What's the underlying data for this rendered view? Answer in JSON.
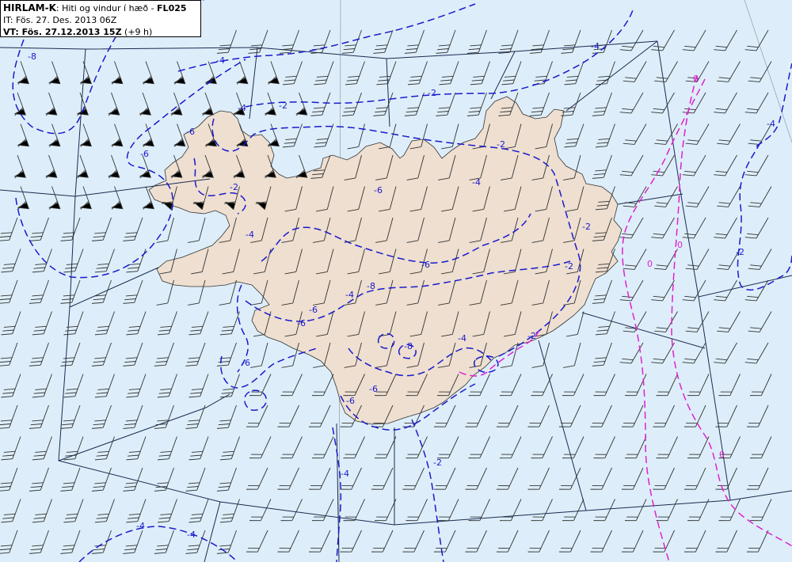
{
  "header": {
    "model": "HIRLAM-K",
    "description": ": Hiti og vindur í hæð - ",
    "level": "FL025",
    "it_line": "IT: Fös. 27. Des. 2013 06Z",
    "vt_label": "VT: ",
    "vt_date": "Fös. 27.12.2013 15Z",
    "vt_lead": " (+9 h)"
  },
  "colors": {
    "sea": "#ddeefa",
    "land": "#eedfd0",
    "contour_negative": "#1a1acc",
    "contour_zero": "#e020d0",
    "sector_lines": "#1a2a50",
    "wind_barbs": "#333333"
  },
  "contour_labels": [
    "-8",
    "-6",
    "-4",
    "-2",
    "-2",
    "-4",
    "-6",
    "-6",
    "-4",
    "-6",
    "-2",
    "-4",
    "-6",
    "-6",
    "-8",
    "-6",
    "-4",
    "-2",
    "-4",
    "-8",
    "-2",
    "-4",
    "-4",
    "-2",
    "-2",
    "-2",
    "0",
    "0",
    "0",
    "0",
    "-6",
    "-6",
    "-4",
    "-2",
    "-4",
    "-4"
  ],
  "legend": {
    "isotherm_interval": "2"
  }
}
